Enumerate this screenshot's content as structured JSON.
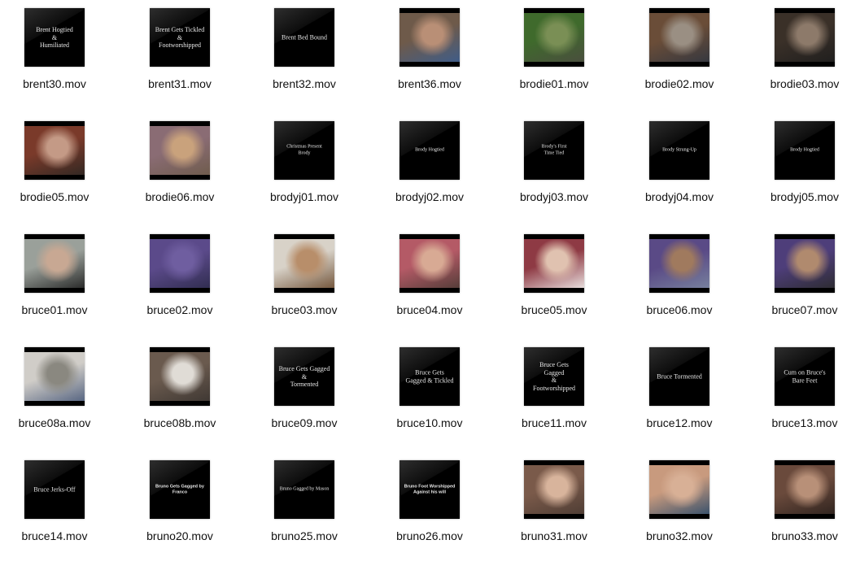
{
  "files": [
    {
      "name": "brent30.mov",
      "kind": "title",
      "text": "Brent Hogtied\n&\nHumiliated"
    },
    {
      "name": "brent31.mov",
      "kind": "title",
      "text": "Brent Gets Tickled\n&\nFootworshipped"
    },
    {
      "name": "brent32.mov",
      "kind": "title",
      "text": "Brent Bed Bound"
    },
    {
      "name": "brent36.mov",
      "kind": "frame",
      "colors": [
        "#6e5a4a",
        "#b98f76",
        "#3a5d8f"
      ]
    },
    {
      "name": "brodie01.mov",
      "kind": "frame",
      "colors": [
        "#3f6a2c",
        "#7a8f55",
        "#4b4b40"
      ]
    },
    {
      "name": "brodie02.mov",
      "kind": "frame",
      "colors": [
        "#6a4d38",
        "#9a8f83",
        "#2f3540"
      ]
    },
    {
      "name": "brodie03.mov",
      "kind": "frame",
      "colors": [
        "#3a3028",
        "#8d7a6a",
        "#1d1d1d"
      ]
    },
    {
      "name": "brodie05.mov",
      "kind": "frame",
      "colors": [
        "#7a3a2a",
        "#c49a86",
        "#2a2622"
      ]
    },
    {
      "name": "brodie06.mov",
      "kind": "frame",
      "colors": [
        "#8a6c74",
        "#c9a27c",
        "#6c5a48"
      ]
    },
    {
      "name": "brodyj01.mov",
      "kind": "title",
      "style": "small",
      "text": "Christmas Present\nBrody"
    },
    {
      "name": "brodyj02.mov",
      "kind": "title",
      "style": "small",
      "text": "Brody Hogtied"
    },
    {
      "name": "brodyj03.mov",
      "kind": "title",
      "style": "small",
      "text": "Brody's First\nTime Tied"
    },
    {
      "name": "brodyj04.mov",
      "kind": "title",
      "style": "small",
      "text": "Brody Strung-Up"
    },
    {
      "name": "brodyj05.mov",
      "kind": "title",
      "style": "small",
      "text": "Brody Hogtied"
    },
    {
      "name": "bruce01.mov",
      "kind": "frame",
      "colors": [
        "#9aa09a",
        "#c8a893",
        "#1d1d1d"
      ]
    },
    {
      "name": "bruce02.mov",
      "kind": "frame",
      "colors": [
        "#5b4a8a",
        "#6f5ea0",
        "#2c2a4a"
      ]
    },
    {
      "name": "bruce03.mov",
      "kind": "frame",
      "colors": [
        "#d8d2c8",
        "#b88e6a",
        "#6a4a2e"
      ]
    },
    {
      "name": "bruce04.mov",
      "kind": "frame",
      "colors": [
        "#b45a66",
        "#d8aa94",
        "#4a3a34"
      ]
    },
    {
      "name": "bruce05.mov",
      "kind": "frame",
      "colors": [
        "#8e3a44",
        "#e0c2b0",
        "#f2f0ee"
      ]
    },
    {
      "name": "bruce06.mov",
      "kind": "frame",
      "colors": [
        "#5a4a86",
        "#a07a5e",
        "#7a86a0"
      ]
    },
    {
      "name": "bruce07.mov",
      "kind": "frame",
      "colors": [
        "#4e3e7a",
        "#b08a6e",
        "#2a2a2a"
      ]
    },
    {
      "name": "bruce08a.mov",
      "kind": "frame",
      "colors": [
        "#d0cdc8",
        "#8a8880",
        "#4a5a7a"
      ]
    },
    {
      "name": "bruce08b.mov",
      "kind": "frame",
      "colors": [
        "#6a5a4e",
        "#e0dcd6",
        "#3a3430"
      ]
    },
    {
      "name": "bruce09.mov",
      "kind": "title",
      "text": "Bruce Gets Gagged\n&\nTormented"
    },
    {
      "name": "bruce10.mov",
      "kind": "title",
      "text": "Bruce Gets\nGagged & Tickled"
    },
    {
      "name": "bruce11.mov",
      "kind": "title",
      "text": "Bruce Gets\nGagged\n&\nFootworshipped"
    },
    {
      "name": "bruce12.mov",
      "kind": "title",
      "text": "Bruce Tormented"
    },
    {
      "name": "bruce13.mov",
      "kind": "title",
      "text": "Cum on Bruce's\nBare Feet"
    },
    {
      "name": "bruce14.mov",
      "kind": "title",
      "text": "Bruce Jerks-Off"
    },
    {
      "name": "bruno20.mov",
      "kind": "title",
      "style": "sans",
      "text": "Bruno Gets Gagged by\nFranco"
    },
    {
      "name": "bruno25.mov",
      "kind": "title",
      "style": "small",
      "text": "Bruno  Gagged  by  Mason"
    },
    {
      "name": "bruno26.mov",
      "kind": "title",
      "style": "sans",
      "text": "Bruno Foot Worshipped\nAgainst his will"
    },
    {
      "name": "bruno31.mov",
      "kind": "frame",
      "colors": [
        "#7a5a4a",
        "#d8b49c",
        "#4a3a32"
      ]
    },
    {
      "name": "bruno32.mov",
      "kind": "frame",
      "colors": [
        "#c89a7e",
        "#d8b096",
        "#2a4a6a"
      ]
    },
    {
      "name": "bruno33.mov",
      "kind": "frame",
      "colors": [
        "#6a4a3c",
        "#b89078",
        "#2a201c"
      ]
    }
  ]
}
